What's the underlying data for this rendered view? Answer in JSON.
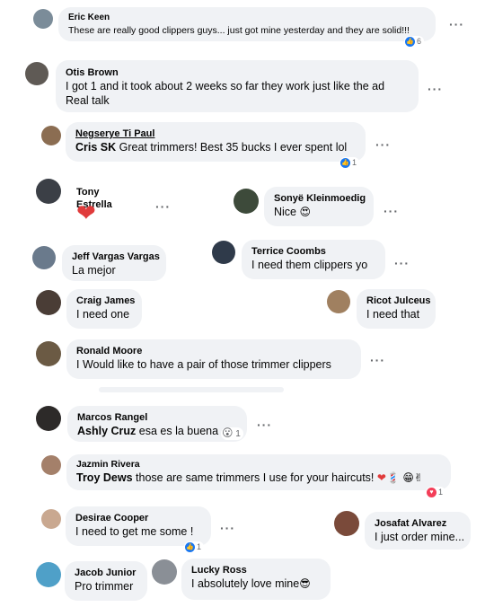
{
  "colors": {
    "bubble": "#f0f2f5",
    "like": "#1877f2",
    "love": "#f33e58",
    "meta": "#65676b"
  },
  "comments": [
    {
      "name": "Eric Keen",
      "text": "These are really good clippers guys... just got mine yesterday and they are solid!!!",
      "reaction": "6",
      "avatar_color": "#7b8c99"
    },
    {
      "name": "Otis Brown",
      "text_line1": "I got 1 and it took about 2 weeks so far they work just like the ad",
      "text_line2": "Real talk",
      "avatar_color": "#5f5a55"
    },
    {
      "name": "Negserye Ti Paul",
      "tag": "Cris SK",
      "text": "Great trimmers! Best 35 bucks I ever spent lol",
      "reaction": "1",
      "avatar_color": "#8b6d52"
    },
    {
      "name": "Tony Estrella",
      "text": "",
      "emoji": "red-heart",
      "avatar_color": "#3b3f46"
    },
    {
      "name": "Sonyë Kleinmoedig",
      "text": "Nice",
      "emoji": "heart-eyes-emoji",
      "avatar_color": "#3d4a3a"
    },
    {
      "name": "Jeff Vargas Vargas",
      "text": "La mejor",
      "avatar_color": "#6a7a8c"
    },
    {
      "name": "Terrice Coombs",
      "text": "I need them clippers yo",
      "avatar_color": "#2f3a4a"
    },
    {
      "name": "Craig James",
      "text": "I need one",
      "avatar_color": "#4a3d36"
    },
    {
      "name": "Ricot Julceus",
      "text": "I need that",
      "avatar_color": "#a08060"
    },
    {
      "name": "Ronald Moore",
      "text": "I Would like to have a pair of those trimmer clippers",
      "avatar_color": "#6b5a44"
    },
    {
      "name": "Marcos Rangel",
      "tag": "Ashly Cruz",
      "text": "esa es la buena",
      "reaction": "1",
      "avatar_color": "#2d2a29"
    },
    {
      "name": "Jazmin Rivera",
      "tag": "Troy Dews",
      "text": "those are same trimmers I use for your haircuts!",
      "reaction": "1",
      "avatar_color": "#a4806a"
    },
    {
      "name": "Desirae Cooper",
      "text": "I need to get me some !",
      "reaction": "1",
      "avatar_color": "#c9a890"
    },
    {
      "name": "Josafat Alvarez",
      "text": "I just order mine...",
      "avatar_color": "#7a4a3a"
    },
    {
      "name": "Jacob Junior",
      "text": "Pro trimmer",
      "avatar_color": "#4fa0c8"
    },
    {
      "name": "Lucky Ross",
      "text": "I absolutely love mine",
      "emoji": "sunglasses-emoji",
      "avatar_color": "#8a8f96"
    }
  ]
}
